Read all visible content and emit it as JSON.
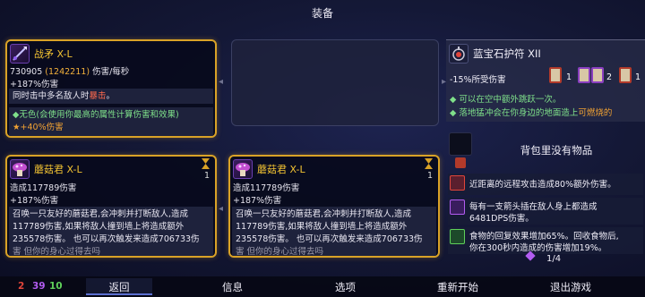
{
  "screen_title": "装备",
  "weapon1": {
    "name": "战矛 X-L",
    "dps_main": "730905",
    "dps_paren": "(1242211)",
    "dps_suffix": "伤害/每秒",
    "bonus": "+187%伤害",
    "desc_prefix": "同时击中多名敌人时",
    "desc_highlight": "暴击",
    "desc_suffix": "。",
    "affix_colorless": "无色(会使用你最高的属性计算伤害和效果)",
    "affix_bonus": "+40%伤害"
  },
  "skill1": {
    "name": "蘑菇君 X-L",
    "cooldown": "1",
    "damage": "造成117789伤害",
    "bonus": "+187%伤害",
    "desc": [
      "召唤一只友好的蘑菇君,会冲刺并打断敌人,造成",
      "117789伤害,如果将敌人撞到墙上将造成额外",
      "235578伤害。 也可以再次触发来造成706733伤",
      "害 但你的身心过得去吗"
    ]
  },
  "skill2": {
    "name": "蘑菇君 X-L",
    "cooldown": "1",
    "damage": "造成117789伤害",
    "bonus": "+187%伤害",
    "desc": [
      "召唤一只友好的蘑菇君,会冲刺并打断敌人,造成",
      "117789伤害,如果将敌人撞到墙上将造成额外",
      "235578伤害。 也可以再次触发来造成706733伤",
      "害 但你的身心过得去吗"
    ]
  },
  "amulet": {
    "name": "蓝宝石护符 XII",
    "scroll_counts": [
      "1",
      "2",
      "1"
    ],
    "stat": "-15%所受伤害",
    "affix1": "可以在空中额外跳跃一次。",
    "affix2_prefix": "落地猛冲会在你身边的地面造上",
    "affix2_highlight": "可燃烧的"
  },
  "bag_empty": "背包里没有物品",
  "mutations": [
    {
      "lines": [
        "近距离的远程攻击造成80%额外伤害。"
      ]
    },
    {
      "lines": [
        "每有一支箭头插在敌人身上都造成",
        "6481DPS伤害。"
      ]
    },
    {
      "lines": [
        "食物的回复效果增加65%。回收食物后,",
        "你在300秒内造成的伤害增加19%。"
      ]
    }
  ],
  "page": "1/4",
  "scroll_stats": [
    "2",
    "39",
    "10"
  ],
  "nav": {
    "back": "返回",
    "info": "信息",
    "options": "选项",
    "restart": "重新开始",
    "quit": "退出游戏"
  },
  "colors": {
    "gold_border": "#d9a227",
    "brutality": "#e0453a",
    "tactics": "#b25cf0",
    "survival": "#5fd05a"
  }
}
